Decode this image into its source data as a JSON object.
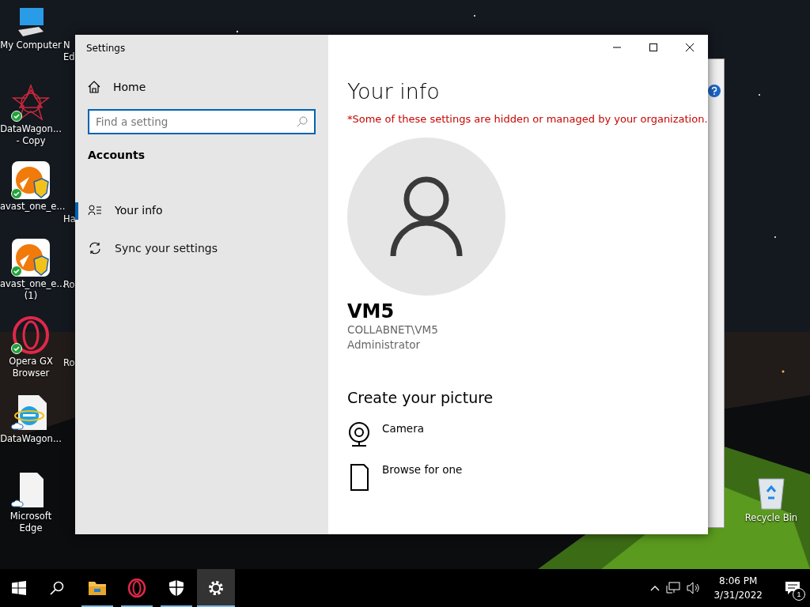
{
  "desktop_icons": [
    {
      "kind": "computer",
      "label": "My Computer",
      "synced": false,
      "cloud_only": false
    },
    {
      "kind": "star",
      "label": "DataWagon... - Copy",
      "synced": true,
      "cloud_only": false
    },
    {
      "kind": "avast",
      "label": "avast_one_e...",
      "synced": true,
      "cloud_only": false
    },
    {
      "kind": "avast",
      "label": "avast_one_e... (1)",
      "synced": true,
      "cloud_only": false
    },
    {
      "kind": "opera",
      "label": "Opera GX Browser",
      "synced": true,
      "cloud_only": false
    },
    {
      "kind": "ie",
      "label": "DataWagon...",
      "synced": false,
      "cloud_only": true
    },
    {
      "kind": "file",
      "label": "Microsoft Edge",
      "synced": false,
      "cloud_only": true
    }
  ],
  "hidden_icon_labels": [
    {
      "label": "N Ed"
    },
    {
      "label": "Ha"
    },
    {
      "label": "Ro"
    },
    {
      "label": "Ro"
    }
  ],
  "recycle_bin": {
    "label": "Recycle Bin"
  },
  "window": {
    "title": "Settings",
    "nav": {
      "home": "Home",
      "search": {
        "placeholder": "Find a setting"
      },
      "section": "Accounts",
      "items": [
        {
          "kind": "info",
          "label": "Your info",
          "selected": true
        },
        {
          "kind": "sync",
          "label": "Sync your settings",
          "selected": false
        }
      ]
    },
    "content": {
      "heading": "Your info",
      "notice": "*Some of these settings are hidden or managed by your organization.",
      "user": {
        "name": "VM5",
        "account": "COLLABNET\\VM5",
        "role": "Administrator"
      },
      "picture_section": "Create your picture",
      "options": [
        {
          "kind": "camera",
          "label": "Camera"
        },
        {
          "kind": "browse",
          "label": "Browse for one"
        }
      ]
    }
  },
  "taskbar": {
    "apps": [
      {
        "kind": "explorer",
        "running": true,
        "active": false
      },
      {
        "kind": "opera",
        "running": true,
        "active": false
      },
      {
        "kind": "shield",
        "running": true,
        "active": false
      },
      {
        "kind": "gear",
        "running": true,
        "active": true
      }
    ],
    "time": "8:06 PM",
    "date": "3/31/2022",
    "notifications": "1"
  }
}
